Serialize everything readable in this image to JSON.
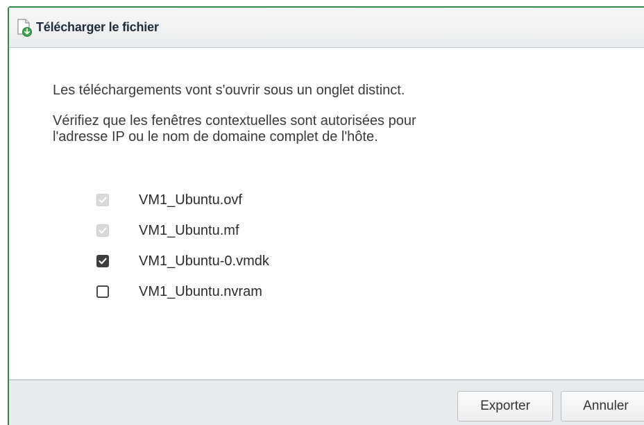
{
  "dialog": {
    "title": "Télécharger le fichier",
    "title_icon": "file-download-icon"
  },
  "body": {
    "message_line1": "Les téléchargements vont s'ouvrir sous un onglet distinct.",
    "message_line2a": "Vérifiez que les fenêtres contextuelles sont autorisées pour",
    "message_line2b": "l'adresse IP ou le nom de domaine complet de l'hôte."
  },
  "files": [
    {
      "name": "VM1_Ubuntu.ovf",
      "checked": true,
      "disabled": true
    },
    {
      "name": "VM1_Ubuntu.mf",
      "checked": true,
      "disabled": true
    },
    {
      "name": "VM1_Ubuntu-0.vmdk",
      "checked": true,
      "disabled": false
    },
    {
      "name": "VM1_Ubuntu.nvram",
      "checked": false,
      "disabled": false
    }
  ],
  "footer": {
    "export_label": "Exporter",
    "cancel_label": "Annuler"
  },
  "colors": {
    "dialog_border": "#2e8b3e",
    "footer_background": "#e9ecef",
    "checkbox_checked": "#3d3d3d",
    "checkbox_disabled": "#d9d9d9"
  }
}
